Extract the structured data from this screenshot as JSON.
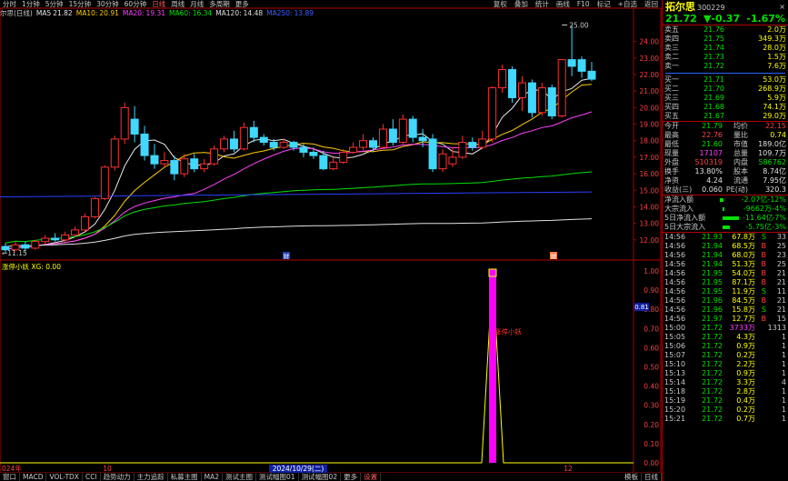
{
  "toolbar": {
    "periods": [
      "分时",
      "1分钟",
      "5分钟",
      "15分钟",
      "30分钟",
      "60分钟",
      "日线",
      "周线",
      "月线",
      "多周期",
      "更多"
    ],
    "active_period": 6,
    "right_items": [
      "复权",
      "叠加",
      "统计",
      "画线",
      "F10",
      "标记",
      "+自选",
      "返回"
    ]
  },
  "legend": {
    "name": "尔思(日线)",
    "items": [
      {
        "label": "MA5",
        "value": "21.82",
        "color": "#e8e8e8"
      },
      {
        "label": "MA10:",
        "value": "20.91",
        "color": "#ffcc00"
      },
      {
        "label": "MA20:",
        "value": "19.31",
        "color": "#ff40ff"
      },
      {
        "label": "MA60:",
        "value": "16.34",
        "color": "#00e000"
      },
      {
        "label": "MA120:",
        "value": "14.48",
        "color": "#e0e0e0"
      },
      {
        "label": "MA250:",
        "value": "13.89",
        "color": "#4060ff"
      }
    ]
  },
  "chart_data": [
    {
      "type": "candlestick",
      "ylim": [
        11.0,
        25.3
      ],
      "yticks": [
        "24.00",
        "23.00",
        "22.00",
        "21.00",
        "20.00",
        "19.00",
        "18.00",
        "17.00",
        "16.00",
        "15.00",
        "14.00",
        "13.00",
        "12.00"
      ],
      "annotations": {
        "high": "25.00",
        "low": "11.15"
      },
      "xlabels": [
        "024年",
        "10",
        "2024/10/29(二)",
        "12"
      ],
      "marker_label": "财",
      "candles": [
        {
          "o": 11.6,
          "c": 11.4,
          "h": 11.8,
          "l": 11.2
        },
        {
          "o": 11.4,
          "c": 11.7,
          "h": 11.9,
          "l": 11.3
        },
        {
          "o": 11.7,
          "c": 11.5,
          "h": 11.9,
          "l": 11.3
        },
        {
          "o": 11.5,
          "c": 11.9,
          "h": 12.0,
          "l": 11.4
        },
        {
          "o": 11.9,
          "c": 12.1,
          "h": 12.3,
          "l": 11.7
        },
        {
          "o": 12.1,
          "c": 12.0,
          "h": 12.4,
          "l": 11.9
        },
        {
          "o": 12.0,
          "c": 12.3,
          "h": 12.5,
          "l": 11.9
        },
        {
          "o": 12.3,
          "c": 12.6,
          "h": 12.8,
          "l": 12.2
        },
        {
          "o": 12.6,
          "c": 13.4,
          "h": 13.6,
          "l": 12.5
        },
        {
          "o": 13.4,
          "c": 14.5,
          "h": 14.6,
          "l": 13.3
        },
        {
          "o": 14.5,
          "c": 16.4,
          "h": 16.5,
          "l": 14.4
        },
        {
          "o": 16.4,
          "c": 18.1,
          "h": 18.3,
          "l": 16.2
        },
        {
          "o": 18.1,
          "c": 20.0,
          "h": 20.3,
          "l": 17.8
        },
        {
          "o": 19.3,
          "c": 18.4,
          "h": 20.1,
          "l": 17.9
        },
        {
          "o": 18.4,
          "c": 17.1,
          "h": 18.9,
          "l": 16.8
        },
        {
          "o": 17.1,
          "c": 16.6,
          "h": 17.8,
          "l": 16.3
        },
        {
          "o": 16.6,
          "c": 16.8,
          "h": 17.3,
          "l": 16.4
        },
        {
          "o": 16.8,
          "c": 16.0,
          "h": 17.1,
          "l": 15.6
        },
        {
          "o": 16.0,
          "c": 16.9,
          "h": 17.2,
          "l": 15.8
        },
        {
          "o": 16.9,
          "c": 16.3,
          "h": 17.2,
          "l": 16.1
        },
        {
          "o": 16.3,
          "c": 16.6,
          "h": 16.9,
          "l": 16.1
        },
        {
          "o": 16.6,
          "c": 17.5,
          "h": 17.7,
          "l": 16.5
        },
        {
          "o": 17.5,
          "c": 18.1,
          "h": 18.3,
          "l": 17.3
        },
        {
          "o": 18.1,
          "c": 17.5,
          "h": 18.6,
          "l": 17.3
        },
        {
          "o": 17.5,
          "c": 18.8,
          "h": 19.1,
          "l": 17.4
        },
        {
          "o": 18.8,
          "c": 18.2,
          "h": 19.2,
          "l": 17.9
        },
        {
          "o": 18.2,
          "c": 17.9,
          "h": 18.4,
          "l": 17.7
        },
        {
          "o": 17.9,
          "c": 17.6,
          "h": 18.1,
          "l": 17.4
        },
        {
          "o": 17.6,
          "c": 17.9,
          "h": 18.1,
          "l": 17.5
        },
        {
          "o": 17.9,
          "c": 17.6,
          "h": 18.0,
          "l": 17.4
        },
        {
          "o": 17.6,
          "c": 17.3,
          "h": 17.8,
          "l": 17.0
        },
        {
          "o": 17.3,
          "c": 17.1,
          "h": 17.6,
          "l": 16.9
        },
        {
          "o": 17.1,
          "c": 16.3,
          "h": 17.4,
          "l": 16.2
        },
        {
          "o": 16.3,
          "c": 16.7,
          "h": 17.0,
          "l": 16.2
        },
        {
          "o": 16.7,
          "c": 17.3,
          "h": 17.5,
          "l": 16.6
        },
        {
          "o": 17.3,
          "c": 17.6,
          "h": 17.9,
          "l": 17.2
        },
        {
          "o": 17.6,
          "c": 18.0,
          "h": 18.4,
          "l": 17.4
        },
        {
          "o": 18.0,
          "c": 17.6,
          "h": 18.2,
          "l": 17.3
        },
        {
          "o": 17.6,
          "c": 18.7,
          "h": 19.0,
          "l": 17.5
        },
        {
          "o": 18.7,
          "c": 17.9,
          "h": 19.3,
          "l": 17.7
        },
        {
          "o": 17.9,
          "c": 19.3,
          "h": 19.6,
          "l": 17.8
        },
        {
          "o": 19.3,
          "c": 18.2,
          "h": 19.5,
          "l": 17.9
        },
        {
          "o": 18.2,
          "c": 18.0,
          "h": 18.7,
          "l": 17.6
        },
        {
          "o": 18.1,
          "c": 16.3,
          "h": 18.4,
          "l": 16.1
        },
        {
          "o": 16.3,
          "c": 17.2,
          "h": 17.5,
          "l": 16.1
        },
        {
          "o": 16.6,
          "c": 17.0,
          "h": 17.6,
          "l": 16.4
        },
        {
          "o": 17.0,
          "c": 17.9,
          "h": 18.3,
          "l": 16.9
        },
        {
          "o": 17.9,
          "c": 17.6,
          "h": 18.2,
          "l": 17.4
        },
        {
          "o": 17.6,
          "c": 18.1,
          "h": 18.6,
          "l": 17.5
        },
        {
          "o": 18.1,
          "c": 21.2,
          "h": 21.3,
          "l": 17.9
        },
        {
          "o": 21.2,
          "c": 22.3,
          "h": 22.6,
          "l": 20.9
        },
        {
          "o": 22.3,
          "c": 20.6,
          "h": 22.5,
          "l": 20.3
        },
        {
          "o": 20.6,
          "c": 21.5,
          "h": 21.9,
          "l": 19.8
        },
        {
          "o": 21.5,
          "c": 19.7,
          "h": 21.7,
          "l": 19.4
        },
        {
          "o": 19.7,
          "c": 21.2,
          "h": 21.5,
          "l": 19.5
        },
        {
          "o": 21.2,
          "c": 19.5,
          "h": 21.4,
          "l": 19.3
        },
        {
          "o": 19.5,
          "c": 22.9,
          "h": 22.9,
          "l": 19.4
        },
        {
          "o": 22.9,
          "c": 22.5,
          "h": 25.0,
          "l": 21.9
        },
        {
          "o": 22.9,
          "c": 22.2,
          "h": 23.1,
          "l": 21.8
        },
        {
          "o": 22.2,
          "c": 21.72,
          "h": 22.76,
          "l": 21.6
        }
      ]
    },
    {
      "type": "line",
      "title": "涨停小妖",
      "series": [
        {
          "name": "XG",
          "value_label": "0.00"
        }
      ],
      "ylim": [
        0,
        1
      ],
      "yticks": [
        "1.00",
        "0.90",
        "0.80",
        "0.70",
        "0.60",
        "0.50",
        "0.40",
        "0.30",
        "0.20",
        "0.10",
        "0.00"
      ],
      "current_label": "0.81",
      "annotation": "涨停小妖",
      "spike_index": 56,
      "values_note": ""
    }
  ],
  "right_panel": {
    "stock_name": "拓尔思",
    "stock_code": "300229",
    "close_label": "×",
    "price": "21.72",
    "change": "▼-0.37",
    "change_pct": "-1.67%",
    "asks": [
      {
        "label": "卖五",
        "price": "21.76",
        "vol": "2.0万"
      },
      {
        "label": "卖四",
        "price": "21.75",
        "vol": "349.3万"
      },
      {
        "label": "卖三",
        "price": "21.74",
        "vol": "28.0万"
      },
      {
        "label": "卖二",
        "price": "21.73",
        "vol": "1.5万"
      },
      {
        "label": "卖一",
        "price": "21.72",
        "vol": "7.6万"
      }
    ],
    "bids": [
      {
        "label": "买一",
        "price": "21.71",
        "vol": "53.0万"
      },
      {
        "label": "买二",
        "price": "21.70",
        "vol": "268.9万"
      },
      {
        "label": "买三",
        "price": "21.69",
        "vol": "5.9万"
      },
      {
        "label": "买四",
        "price": "21.68",
        "vol": "74.1万"
      },
      {
        "label": "买五",
        "price": "21.67",
        "vol": "29.0万"
      }
    ],
    "stats": [
      {
        "k": "今开",
        "v": "21.79",
        "vc": "c-green",
        "k2": "均价",
        "v2": "22.15",
        "v2c": "c-red"
      },
      {
        "k": "最高",
        "v": "22.76",
        "vc": "c-red",
        "k2": "量比",
        "v2": "0.74",
        "v2c": "c-yellow"
      },
      {
        "k": "最低",
        "v": "21.60",
        "vc": "c-green",
        "k2": "市值",
        "v2": "189.0亿",
        "v2c": "c-white"
      },
      {
        "k": "现量",
        "v": "17107",
        "vc": "c-purple",
        "k2": "总量",
        "v2": "109.7万",
        "v2c": "c-white"
      },
      {
        "k": "外盘",
        "v": "510319",
        "vc": "c-red",
        "k2": "内盘",
        "v2": "586762",
        "v2c": "c-green"
      },
      {
        "k": "换手",
        "v": "13.80%",
        "vc": "c-white",
        "k2": "股本",
        "v2": "8.74亿",
        "v2c": "c-white"
      },
      {
        "k": "净资",
        "v": "4.24",
        "vc": "c-white",
        "k2": "流通",
        "v2": "7.95亿",
        "v2c": "c-white"
      },
      {
        "k": "收益(三)",
        "v": "0.060",
        "vc": "c-white",
        "k2": "PE(动)",
        "v2": "320.3",
        "v2c": "c-white"
      }
    ],
    "flows": [
      {
        "k": "净流入额",
        "bar": 4,
        "v": "-2.07亿",
        "pc": "-12%"
      },
      {
        "k": "大宗流入",
        "bar": 2,
        "v": "-9662万",
        "pc": "-4%"
      },
      {
        "k": "5日净流入额",
        "bar": 18,
        "v": "-11.64亿",
        "pc": "-7%"
      },
      {
        "k": "5日大宗流入",
        "bar": 8,
        "v": "-5.75亿",
        "pc": "-3%"
      }
    ],
    "ticks": [
      {
        "t": "14:56",
        "p": "21.93",
        "v": "67.8万",
        "bs": "S",
        "n": "33"
      },
      {
        "t": "14:56",
        "p": "21.94",
        "v": "68.5万",
        "bs": "B",
        "n": "25"
      },
      {
        "t": "14:56",
        "p": "21.94",
        "v": "68.0万",
        "bs": "B",
        "n": "23"
      },
      {
        "t": "14:56",
        "p": "21.94",
        "v": "51.3万",
        "bs": "B",
        "n": "25"
      },
      {
        "t": "14:56",
        "p": "21.95",
        "v": "54.0万",
        "bs": "B",
        "n": "21"
      },
      {
        "t": "14:56",
        "p": "21.95",
        "v": "87.1万",
        "bs": "B",
        "n": "21"
      },
      {
        "t": "14:56",
        "p": "21.95",
        "v": "11.9万",
        "bs": "S",
        "n": "11"
      },
      {
        "t": "14:56",
        "p": "21.96",
        "v": "84.5万",
        "bs": "B",
        "n": "21"
      },
      {
        "t": "14:56",
        "p": "21.96",
        "v": "15.8万",
        "bs": "S",
        "n": "21"
      },
      {
        "t": "14:56",
        "p": "21.97",
        "v": "12.7万",
        "bs": "B",
        "n": "15"
      },
      {
        "t": "15:00",
        "p": "21.72",
        "v": "3733万",
        "bs": "",
        "n": "1313"
      },
      {
        "t": "15:05",
        "p": "21.72",
        "v": "4.3万",
        "bs": "",
        "n": "1"
      },
      {
        "t": "15:06",
        "p": "21.72",
        "v": "0.9万",
        "bs": "",
        "n": "1"
      },
      {
        "t": "15:07",
        "p": "21.72",
        "v": "0.2万",
        "bs": "",
        "n": "1"
      },
      {
        "t": "15:10",
        "p": "21.72",
        "v": "2.2万",
        "bs": "",
        "n": "1"
      },
      {
        "t": "15:13",
        "p": "21.72",
        "v": "0.9万",
        "bs": "",
        "n": "1"
      },
      {
        "t": "15:14",
        "p": "21.72",
        "v": "3.3万",
        "bs": "",
        "n": "4"
      },
      {
        "t": "15:18",
        "p": "21.72",
        "v": "2.8万",
        "bs": "",
        "n": "1"
      },
      {
        "t": "15:19",
        "p": "21.72",
        "v": "0.4万",
        "bs": "",
        "n": "1"
      },
      {
        "t": "15:20",
        "p": "21.72",
        "v": "0.2万",
        "bs": "",
        "n": "1"
      },
      {
        "t": "15:21",
        "p": "21.72",
        "v": "0.7万",
        "bs": "",
        "n": "1"
      }
    ]
  },
  "bottombar": {
    "tabs": [
      "窗口",
      "MACD",
      "VOL-TDX",
      "CCI",
      "趋势动力",
      "主力追踪",
      "私募主图",
      "MA2",
      "测试主图",
      "测试幅图01",
      "测试幅图02",
      "更多",
      "设置"
    ],
    "active_tab": 12,
    "right": [
      "模板",
      "日线"
    ]
  }
}
